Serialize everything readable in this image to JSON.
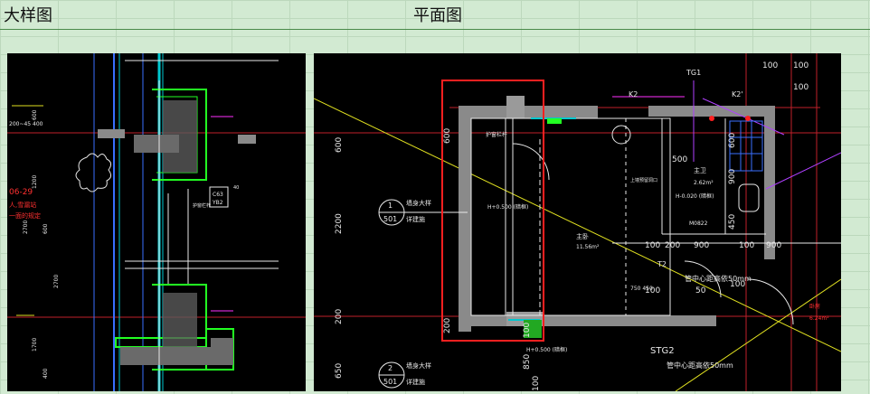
{
  "headers": {
    "left": "大样图",
    "right": "平面图"
  },
  "detail": {
    "dims": [
      "600",
      "1200",
      "600",
      "2700",
      "2700",
      "1700",
      "400"
    ],
    "note_number": "06-29",
    "note_line1": "人,雪漏站",
    "note_line2": "一面的规定",
    "tag_top": "C63",
    "tag_bottom": "YB2",
    "label_rail": "护窗栏杆",
    "label_left": "200~45 400",
    "label_small": "40"
  },
  "plan": {
    "dims_top": [
      "100",
      "100",
      "100"
    ],
    "dims_left": [
      "600",
      "2200",
      "200",
      "650",
      "200",
      "600"
    ],
    "dims_right": [
      "600",
      "450",
      "900"
    ],
    "dims_mid": [
      "100",
      "200",
      "900",
      "100",
      "900",
      "100",
      "50",
      "100"
    ],
    "dims_bottom": [
      "100",
      "850",
      "100"
    ],
    "callout1_num": "1",
    "callout1_sheet": "501",
    "callout2_num": "2",
    "callout2_sheet": "501",
    "label_wall_detail": "墙身大样",
    "label_see": "详建施",
    "label_guardrail": "护窗栏杆",
    "label_height1": "H+0.500 (暗框)",
    "label_height2": "H+0.500 (暗框)",
    "label_height3": "H-0.020 (暗框)",
    "label_master": "主卧",
    "label_area": "11.56m²",
    "label_pipe1": "管中心距高依50mm",
    "label_pipe2": "管中心距高依50mm",
    "label_stg": "STG2",
    "label_k2": "K2",
    "label_k2b": "K2'",
    "label_tg1": "TG1",
    "label_t2": "T2",
    "label_m0822": "M0822",
    "label_bath": "主卫",
    "label_bath_area": "2.62m²",
    "label_elev": "750 450",
    "label_hole": "上墙预留洞口",
    "label_room2": "卧房",
    "label_room2_area": "6.24m²",
    "label_500": "500"
  }
}
